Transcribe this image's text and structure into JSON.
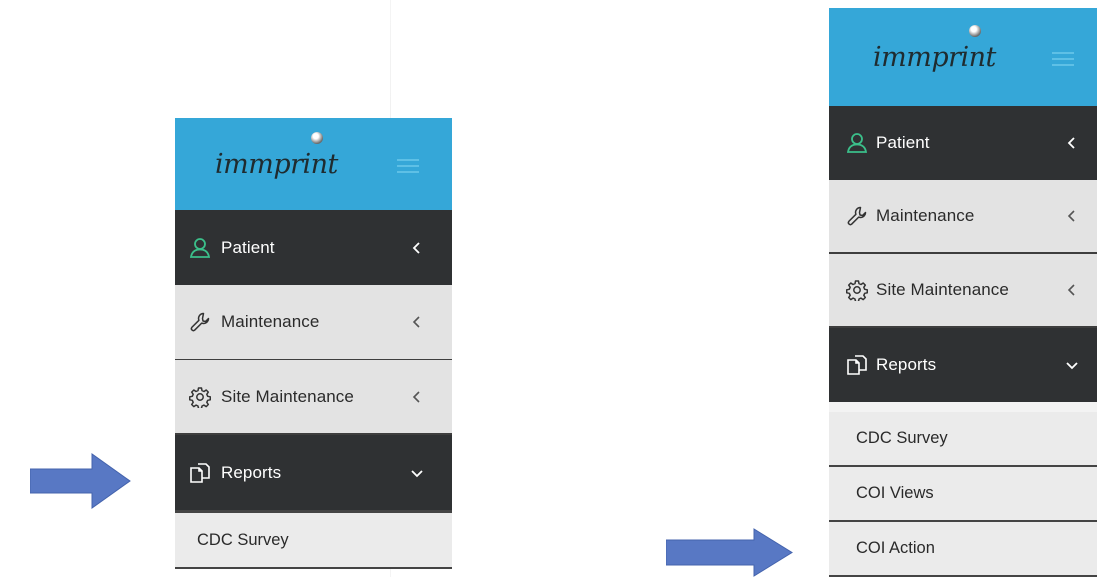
{
  "brand": {
    "logo_text": "immprint"
  },
  "colors": {
    "brand_bar": "#35a7d8",
    "dark_item": "#2f3133",
    "light_item": "#e3e3e3",
    "patient_icon": "#3bbf8a",
    "pointer_arrow": "#5878c4"
  },
  "left_panel": {
    "menu": [
      {
        "label": "Patient",
        "icon": "user-icon",
        "chevron": "chevron-left-icon",
        "active": true
      },
      {
        "label": "Maintenance",
        "icon": "wrench-icon",
        "chevron": "chevron-left-icon",
        "active": false
      },
      {
        "label": "Site Maintenance",
        "icon": "gear-icon",
        "chevron": "chevron-left-icon",
        "active": false
      },
      {
        "label": "Reports",
        "icon": "document-icon",
        "chevron": "chevron-down-icon",
        "active": true
      }
    ],
    "submenu": [
      "CDC Survey"
    ]
  },
  "right_panel": {
    "menu": [
      {
        "label": "Patient",
        "icon": "user-icon",
        "chevron": "chevron-left-icon",
        "active": true
      },
      {
        "label": "Maintenance",
        "icon": "wrench-icon",
        "chevron": "chevron-left-icon",
        "active": false
      },
      {
        "label": "Site Maintenance",
        "icon": "gear-icon",
        "chevron": "chevron-left-icon",
        "active": false
      },
      {
        "label": "Reports",
        "icon": "document-icon",
        "chevron": "chevron-down-icon",
        "active": true
      }
    ],
    "submenu": [
      "CDC Survey",
      "COI Views",
      "COI Action"
    ]
  },
  "annotations": [
    {
      "type": "pointer-arrow",
      "points_to": "left_panel.menu.3"
    },
    {
      "type": "pointer-arrow",
      "points_to": "right_panel.submenu.2"
    }
  ]
}
